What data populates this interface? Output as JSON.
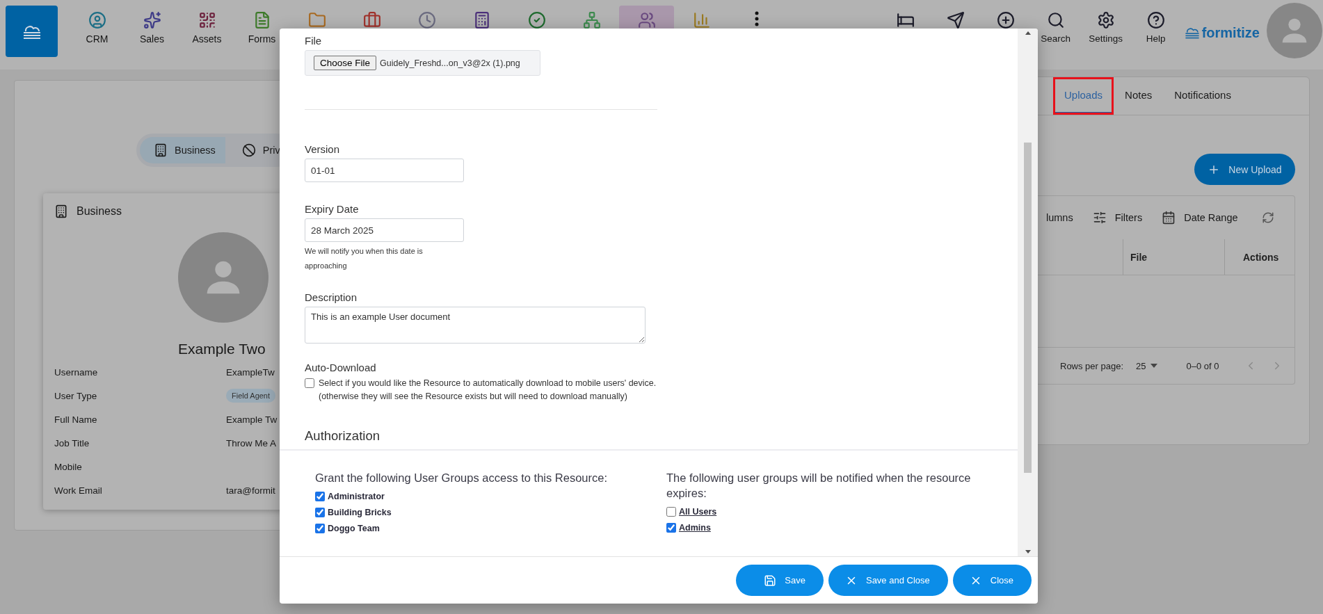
{
  "nav": {
    "items": [
      {
        "label": "CRM",
        "selected": false
      },
      {
        "label": "Sales",
        "selected": false
      },
      {
        "label": "Assets",
        "selected": false
      },
      {
        "label": "Forms",
        "selected": false
      },
      {
        "selected": false
      },
      {
        "selected": false
      },
      {
        "selected": false
      },
      {
        "selected": false
      },
      {
        "selected": false
      },
      {
        "selected": false
      },
      {
        "selected": true
      },
      {
        "selected": false
      },
      {
        "selected": false
      }
    ],
    "actions": [
      {
        "kind": "icon"
      },
      {
        "kind": "icon"
      },
      {
        "kind": "icon"
      },
      {
        "kind": "labeled",
        "label": "Search"
      },
      {
        "kind": "labeled",
        "label": "Settings"
      },
      {
        "kind": "labeled",
        "label": "Help"
      }
    ],
    "brand": "formitize"
  },
  "profile": {
    "view_toggle": [
      {
        "label": "Business",
        "selected": true
      },
      {
        "label": "Priv",
        "selected": false
      }
    ],
    "card": {
      "title": "Business",
      "name": "Example Two",
      "fields": [
        {
          "label": "Username",
          "kind": "text",
          "value": "ExampleTw"
        },
        {
          "label": "User Type",
          "kind": "chip",
          "value": "Field Agent"
        },
        {
          "label": "Full Name",
          "kind": "text",
          "value": "Example Tw"
        },
        {
          "label": "Job Title",
          "kind": "text",
          "value": "Throw Me A"
        },
        {
          "label": "Mobile",
          "kind": "text"
        },
        {
          "label": "Work Email",
          "kind": "text",
          "value": "tara@formit"
        }
      ]
    }
  },
  "panel": {
    "tabs": [
      {
        "label": "Uploads",
        "selected": true,
        "highlighted": true
      },
      {
        "label": "Notes",
        "selected": false,
        "highlighted": false
      },
      {
        "label": "Notifications",
        "selected": false,
        "highlighted": false
      }
    ],
    "new_upload_button": "New Upload",
    "toolbar": [
      {
        "kind": "plain",
        "label": "lumns"
      },
      {
        "kind": "filters",
        "label": "Filters"
      },
      {
        "kind": "date",
        "label": "Date Range"
      }
    ],
    "table": {
      "columns": [
        "File",
        "Actions"
      ]
    },
    "pagination": {
      "rows_per_page_label": "Rows per page:",
      "rows_per_page": "25",
      "range": "0–0 of 0"
    }
  },
  "modal": {
    "file": {
      "label": "File",
      "button": "Choose File",
      "filename": "Guidely_Freshd...on_v3@2x (1).png"
    },
    "version": {
      "label": "Version",
      "value": "01-01"
    },
    "expiry": {
      "label": "Expiry Date",
      "value": "28 March 2025",
      "help": "We will notify you when this date is approaching"
    },
    "description": {
      "label": "Description",
      "value": "This is an example User document"
    },
    "auto_download": {
      "label": "Auto-Download",
      "checked": false,
      "text": "Select if you would like the Resource to automatically download to mobile users' device.",
      "note": "(otherwise they will see the Resource exists but will need to download manually)"
    },
    "authorization": {
      "title": "Authorization",
      "access": {
        "heading": "Grant the following User Groups access to this Resource:",
        "groups": [
          {
            "label": "Administrator",
            "checked": true
          },
          {
            "label": "Building Bricks",
            "checked": true
          },
          {
            "label": "Doggo Team",
            "checked": true
          }
        ]
      },
      "notify": {
        "heading": "The following user groups will be notified when the resource expires:",
        "groups": [
          {
            "label": "All Users",
            "checked": false
          },
          {
            "label": "Admins",
            "checked": true
          }
        ]
      }
    },
    "buttons": [
      {
        "label": "Save",
        "kind": "save"
      },
      {
        "label": "Save and Close",
        "kind": "close"
      },
      {
        "label": "Close",
        "kind": "close"
      }
    ]
  }
}
